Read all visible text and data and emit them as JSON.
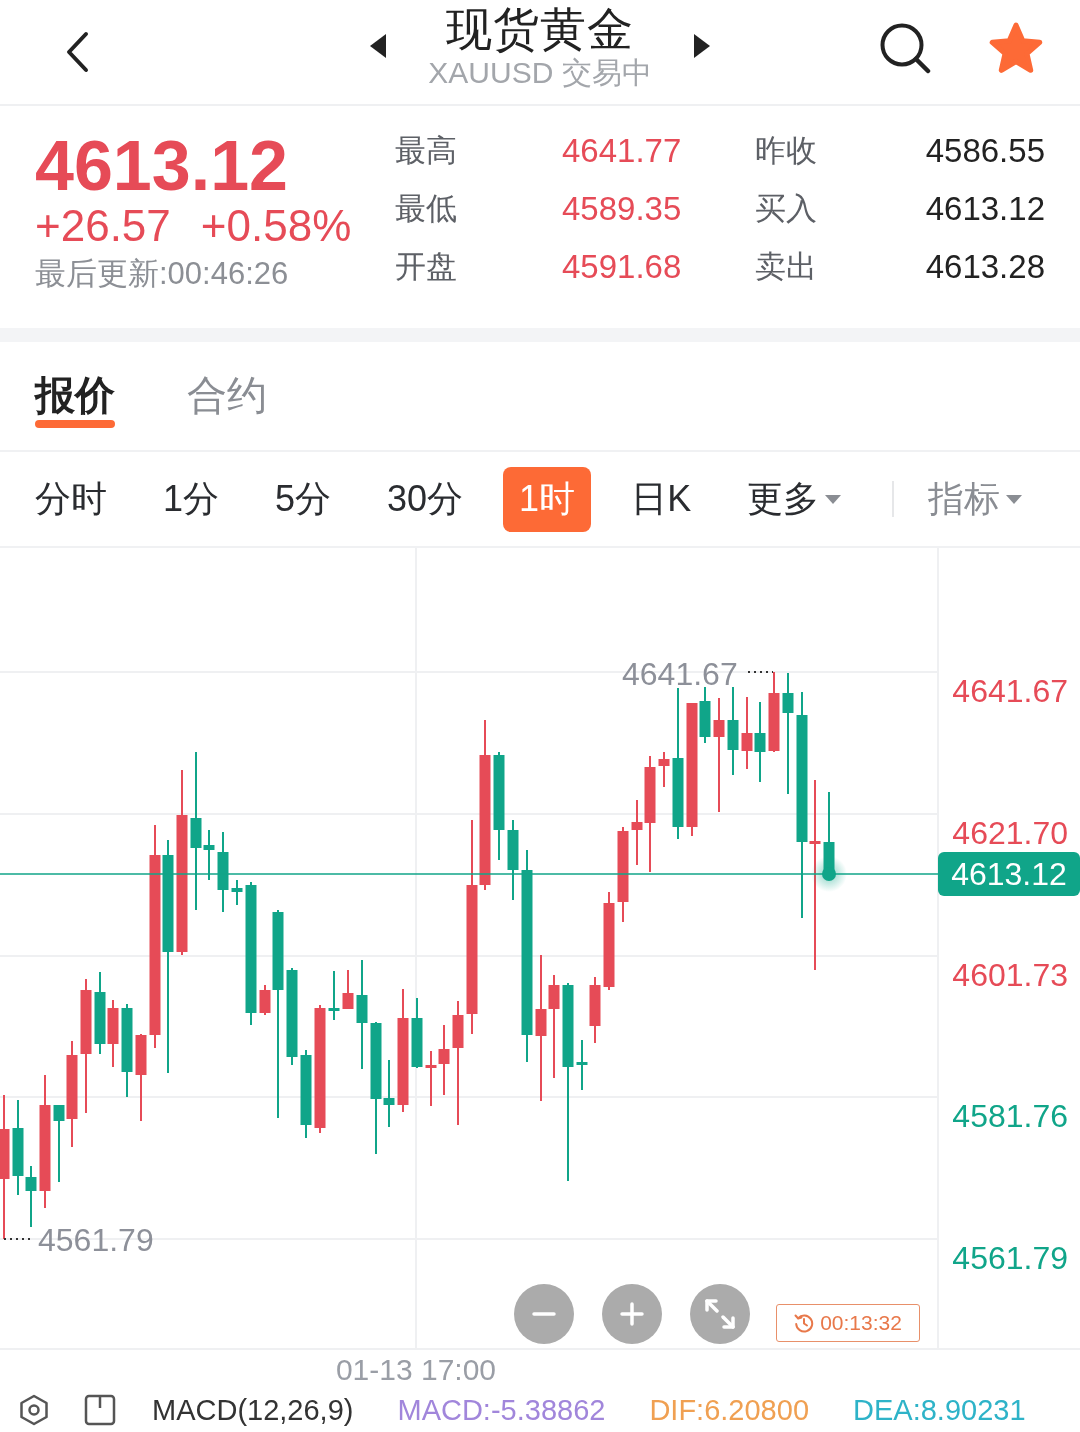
{
  "header": {
    "title": "现货黄金",
    "subtitle": "XAUUSD 交易中",
    "favorited": true
  },
  "quote": {
    "price": "4613.12",
    "change": "+26.57",
    "change_percent": "+0.58%",
    "rising": true,
    "updated": "最后更新:00:46:26",
    "stats": [
      {
        "label": "最高",
        "value": "4641.77",
        "color": "#e64b57"
      },
      {
        "label": "昨收",
        "value": "4586.55",
        "color": "#222222"
      },
      {
        "label": "最低",
        "value": "4589.35",
        "color": "#e64b57"
      },
      {
        "label": "买入",
        "value": "4613.12",
        "color": "#222222"
      },
      {
        "label": "开盘",
        "value": "4591.68",
        "color": "#e64b57"
      },
      {
        "label": "卖出",
        "value": "4613.28",
        "color": "#222222"
      }
    ]
  },
  "tabs": [
    {
      "label": "报价",
      "selected": true
    },
    {
      "label": "合约",
      "selected": false
    }
  ],
  "periods": [
    {
      "label": "分时",
      "kind": "period",
      "selected": false
    },
    {
      "label": "1分",
      "kind": "period",
      "selected": false
    },
    {
      "label": "5分",
      "kind": "period",
      "selected": false
    },
    {
      "label": "30分",
      "kind": "period",
      "selected": false
    },
    {
      "label": "1时",
      "kind": "period",
      "selected": true
    },
    {
      "label": "日K",
      "kind": "period",
      "selected": false
    },
    {
      "label": "更多",
      "kind": "dropdown",
      "selected": false
    }
  ],
  "indicator_menu": {
    "label": "指标"
  },
  "chart": {
    "price_labels": [
      {
        "label": "4641.67",
        "color": "#e64b57"
      },
      {
        "label": "4621.70",
        "color": "#e64b57"
      },
      {
        "label": "4601.73",
        "color": "#e64b57"
      },
      {
        "label": "4581.76",
        "color": "#10a589"
      },
      {
        "label": "4561.79",
        "color": "#10a589"
      }
    ],
    "current_price": "4613.12",
    "high_label": "4641.67",
    "low_label": "4561.79",
    "time_label": "01-13 17:00",
    "countdown": "00:13:32"
  },
  "indicator_bar": {
    "name": "MACD(12,26,9)",
    "values": [
      {
        "label": "MACD:-5.38862",
        "color": "#a186db"
      },
      {
        "label": "DIF:6.20800",
        "color": "#f0a052"
      },
      {
        "label": "DEA:8.90231",
        "color": "#2eb3c8"
      }
    ]
  }
}
